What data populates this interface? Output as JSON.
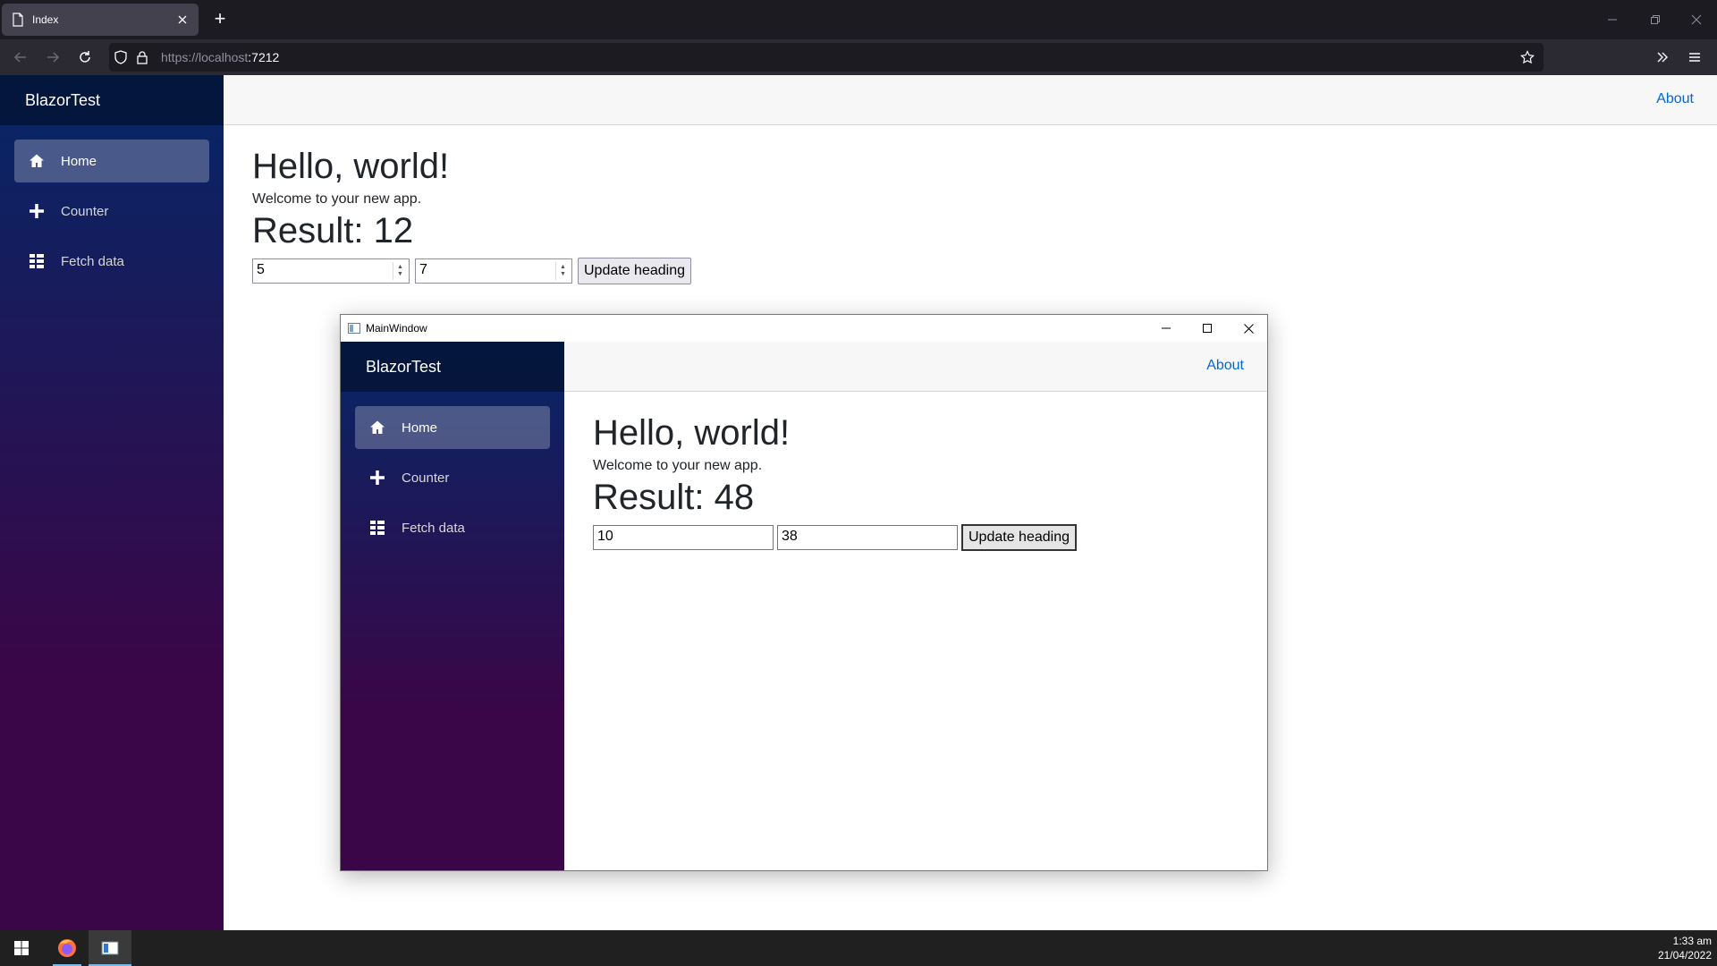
{
  "browser": {
    "tab_title": "Index",
    "url_host": "https://localhost",
    "url_port": ":7212"
  },
  "app": {
    "brand": "BlazorTest",
    "about": "About",
    "nav": [
      {
        "label": "Home",
        "icon": "home-icon",
        "active": true
      },
      {
        "label": "Counter",
        "icon": "plus-icon",
        "active": false
      },
      {
        "label": "Fetch data",
        "icon": "list-icon",
        "active": false
      }
    ],
    "heading": "Hello, world!",
    "welcome": "Welcome to your new app.",
    "result": "Result: 12",
    "input1": "5",
    "input2": "7",
    "button": "Update heading"
  },
  "wpf": {
    "window_title": "MainWindow",
    "brand": "BlazorTest",
    "about": "About",
    "nav": [
      {
        "label": "Home",
        "icon": "home-icon",
        "active": true
      },
      {
        "label": "Counter",
        "icon": "plus-icon",
        "active": false
      },
      {
        "label": "Fetch data",
        "icon": "list-icon",
        "active": false
      }
    ],
    "heading": "Hello, world!",
    "welcome": "Welcome to your new app.",
    "result": "Result: 48",
    "input1": "10",
    "input2": "38",
    "button": "Update heading"
  },
  "taskbar": {
    "time": "1:33 am",
    "date": "21/04/2022"
  },
  "colors": {
    "sidebar_top": "#052767",
    "sidebar_bottom": "#3a0647",
    "link": "#0366d6",
    "browser_bg": "#1c1b22"
  }
}
